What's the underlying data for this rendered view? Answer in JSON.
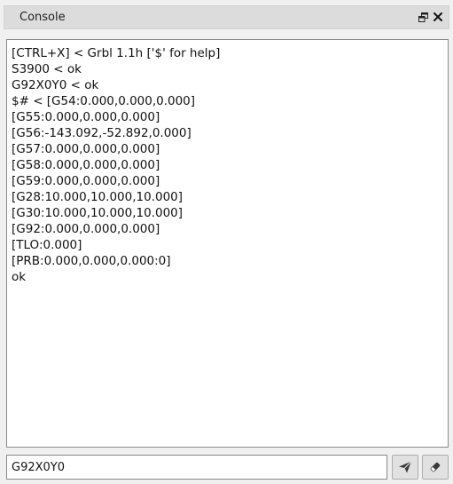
{
  "window": {
    "title": "Console",
    "float_icon": "float-window-icon",
    "close_icon": "close-icon"
  },
  "console": {
    "lines": [
      "[CTRL+X] < Grbl 1.1h ['$' for help]",
      "S3900 < ok",
      "G92X0Y0 < ok",
      "$# < [G54:0.000,0.000,0.000]",
      "[G55:0.000,0.000,0.000]",
      "[G56:-143.092,-52.892,0.000]",
      "[G57:0.000,0.000,0.000]",
      "[G58:0.000,0.000,0.000]",
      "[G59:0.000,0.000,0.000]",
      "[G28:10.000,10.000,10.000]",
      "[G30:10.000,10.000,10.000]",
      "[G92:0.000,0.000,0.000]",
      "[TLO:0.000]",
      "[PRB:0.000,0.000,0.000:0]",
      "ok"
    ]
  },
  "command": {
    "value": "G92X0Y0"
  },
  "buttons": {
    "send_icon": "send-icon",
    "clear_icon": "eraser-icon"
  }
}
